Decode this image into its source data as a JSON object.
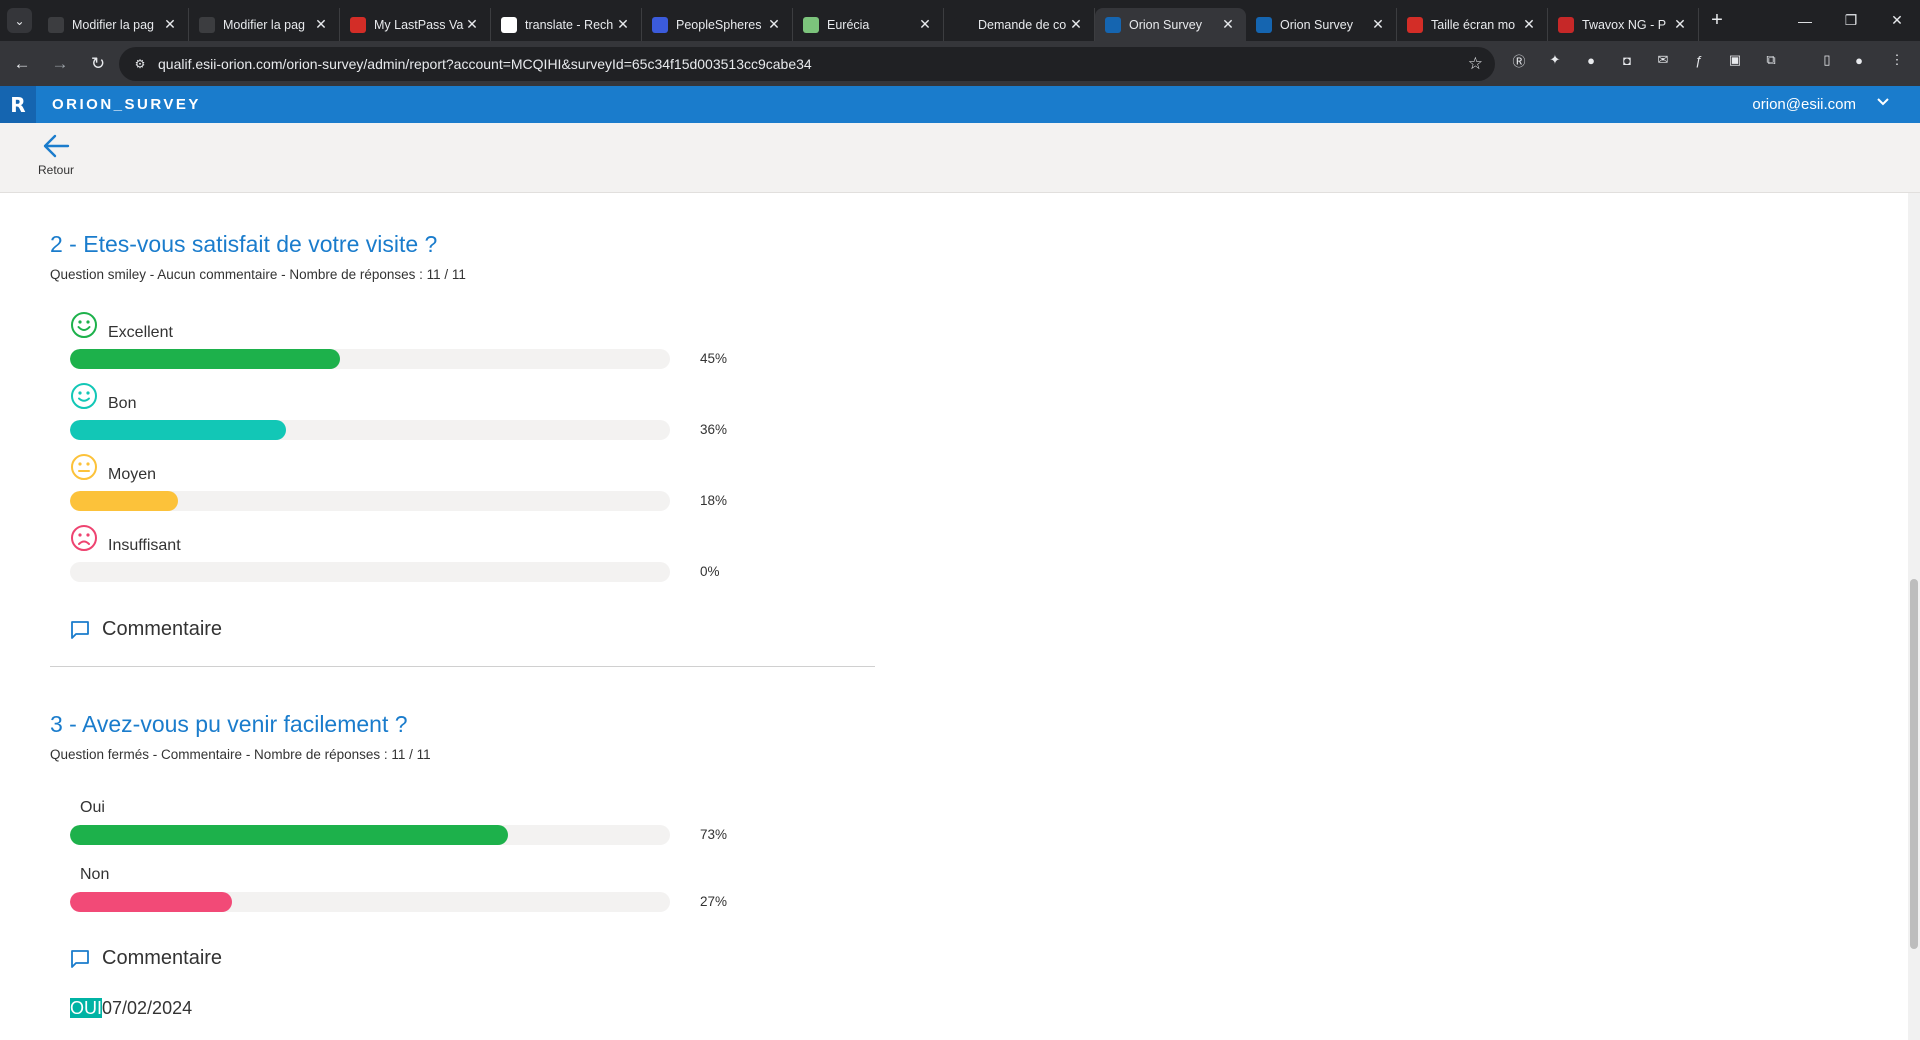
{
  "browser": {
    "tabs": [
      {
        "title": "Modifier la pag",
        "icon": "wordpress-icon",
        "color": "#3c3d40"
      },
      {
        "title": "Modifier la pag",
        "icon": "wordpress-icon",
        "color": "#3c3d40"
      },
      {
        "title": "My LastPass Va",
        "icon": "lastpass-icon",
        "color": "#d32d27"
      },
      {
        "title": "translate - Rech",
        "icon": "google-icon",
        "color": "#ffffff"
      },
      {
        "title": "PeopleSpheres",
        "icon": "peoplespheres-icon",
        "color": "#3b5bdb"
      },
      {
        "title": "Eurécia",
        "icon": "eurecia-icon",
        "color": "#7cc47c"
      },
      {
        "title": "Demande de co",
        "icon": "document-icon",
        "color": "#202124"
      },
      {
        "title": "Orion Survey",
        "icon": "orion-icon",
        "color": "#1565b0"
      },
      {
        "title": "Orion Survey",
        "icon": "orion-icon",
        "color": "#1565b0"
      },
      {
        "title": "Taille écran mo",
        "icon": "circle-icon",
        "color": "#d32d27"
      },
      {
        "title": "Twavox NG - P",
        "icon": "esii-icon",
        "color": "#c62828"
      }
    ],
    "active_tab": 7,
    "url": "qualif.esii-orion.com/orion-survey/admin/report?account=MCQIHI&surveyId=65c34f15d003513cc9cabe34"
  },
  "header": {
    "logo_letter": "R",
    "brand": "ORION_SURVEY",
    "user_email": "orion@esii.com"
  },
  "subheader": {
    "back_label": "Retour"
  },
  "questions": [
    {
      "title": "2 - Etes-vous satisfait de votre visite ?",
      "meta": "Question smiley - Aucun commentaire - Nombre de réponses : 11 / 11",
      "answers": [
        {
          "label": "Excellent",
          "percent": 45,
          "percent_text": "45%",
          "color": "#1db14b",
          "icon": "smiley-happy-icon"
        },
        {
          "label": "Bon",
          "percent": 36,
          "percent_text": "36%",
          "color": "#12c7b6",
          "icon": "smiley-good-icon"
        },
        {
          "label": "Moyen",
          "percent": 18,
          "percent_text": "18%",
          "color": "#fcc23a",
          "icon": "smiley-neutral-icon"
        },
        {
          "label": "Insuffisant",
          "percent": 0,
          "percent_text": "0%",
          "color": "#ee4370",
          "icon": "smiley-sad-icon"
        }
      ],
      "comment_label": "Commentaire"
    },
    {
      "title": "3 - Avez-vous pu venir facilement ?",
      "meta": "Question fermés - Commentaire - Nombre de réponses : 11 / 11",
      "answers": [
        {
          "label": "Oui",
          "percent": 73,
          "percent_text": "73%",
          "color": "#1db14b"
        },
        {
          "label": "Non",
          "percent": 27,
          "percent_text": "27%",
          "color": "#f24a77"
        }
      ],
      "comment_label": "Commentaire",
      "first_comment": {
        "tag": "OUI",
        "date": "07/02/2024"
      }
    }
  ],
  "colors": {
    "accent": "#1a7ccc",
    "header_dark": "#1565b0",
    "tag": "#00b3a4"
  }
}
